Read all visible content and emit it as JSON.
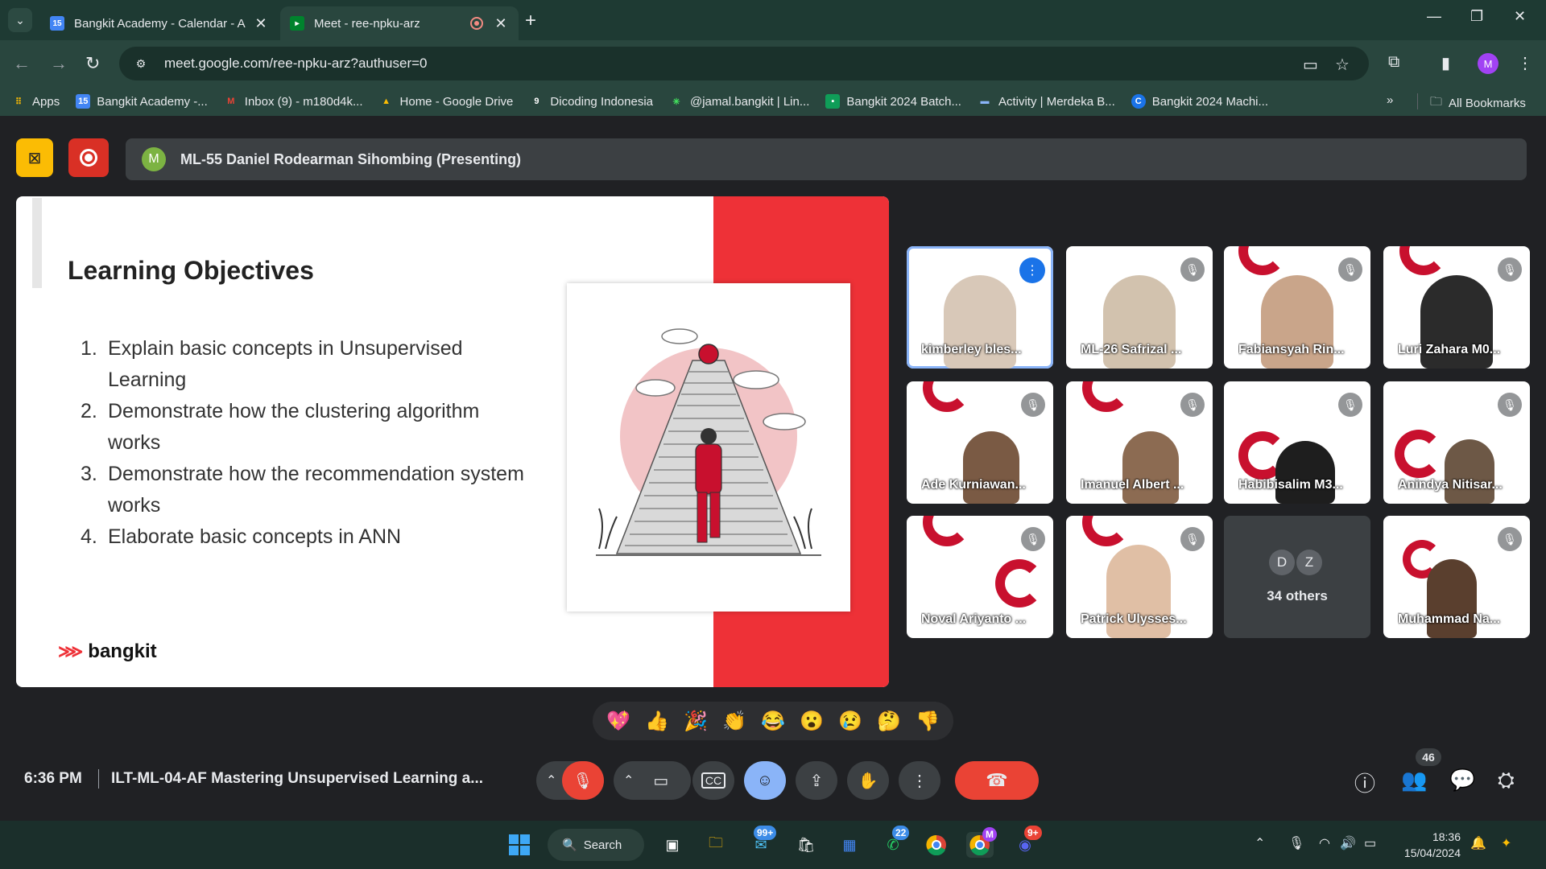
{
  "browser": {
    "tabs": [
      {
        "title": "Bangkit Academy - Calendar - A",
        "favicon_text": "15",
        "favicon_color": "#4285f4"
      },
      {
        "title": "Meet - ree-npku-arz",
        "favicon_color": "#00832d"
      }
    ],
    "url": "meet.google.com/ree-npku-arz?authuser=0",
    "profile_initial": "M",
    "bookmarks": [
      {
        "label": "Apps",
        "icon": "apps-grid-icon"
      },
      {
        "label": "Bangkit Academy -...",
        "icon": "calendar-icon"
      },
      {
        "label": "Inbox (9) - m180d4k...",
        "icon": "gmail-icon"
      },
      {
        "label": "Home - Google Drive",
        "icon": "drive-icon"
      },
      {
        "label": "Dicoding Indonesia",
        "icon": "dicoding-icon"
      },
      {
        "label": "@jamal.bangkit | Lin...",
        "icon": "linktree-icon"
      },
      {
        "label": "Bangkit 2024 Batch...",
        "icon": "classroom-icon"
      },
      {
        "label": "Activity | Merdeka B...",
        "icon": "merdeka-icon"
      },
      {
        "label": "Bangkit 2024 Machi...",
        "icon": "c-icon"
      }
    ],
    "all_bookmarks": "All Bookmarks"
  },
  "meet": {
    "presenter_initial": "M",
    "presenter_label": "ML-55 Daniel Rodearman Sihombing (Presenting)",
    "slide": {
      "title": "Learning Objectives",
      "objectives": [
        {
          "num": "1.",
          "text": "Explain basic concepts in Unsupervised Learning"
        },
        {
          "num": "2.",
          "text": "Demonstrate how the clustering algorithm works"
        },
        {
          "num": "3.",
          "text": "Demonstrate how the recommendation system works"
        },
        {
          "num": "4.",
          "text": "Elaborate basic concepts in ANN"
        }
      ],
      "logo_text": "bangkit"
    },
    "participants": [
      {
        "name": "kimberley bles...",
        "speaking": true
      },
      {
        "name": "ML-26 Safrizal ..."
      },
      {
        "name": "Fabiansyah Rin..."
      },
      {
        "name": "Luri Zahara M0..."
      },
      {
        "name": "Ade Kurniawan..."
      },
      {
        "name": "Imanuel Albert ..."
      },
      {
        "name": "Habibisalim M3..."
      },
      {
        "name": "Anindya Nitisar..."
      },
      {
        "name": "Noval Ariyanto ..."
      },
      {
        "name": "Patrick Ulysses..."
      },
      {
        "name": "Muhammad Na..."
      }
    ],
    "others": {
      "initials": [
        "D",
        "Z"
      ],
      "label": "34 others"
    },
    "reactions": [
      "💖",
      "👍",
      "🎉",
      "👏",
      "😂",
      "😮",
      "😢",
      "🤔",
      "👎"
    ],
    "time": "6:36 PM",
    "meeting_title": "ILT-ML-04-AF Mastering Unsupervised Learning a...",
    "participant_count": "46"
  },
  "taskbar": {
    "search_label": "Search",
    "mail_badge": "99+",
    "whatsapp_badge": "22",
    "discord_badge": "9+",
    "chrome_profile": "M",
    "time": "18:36",
    "date": "15/04/2024"
  }
}
